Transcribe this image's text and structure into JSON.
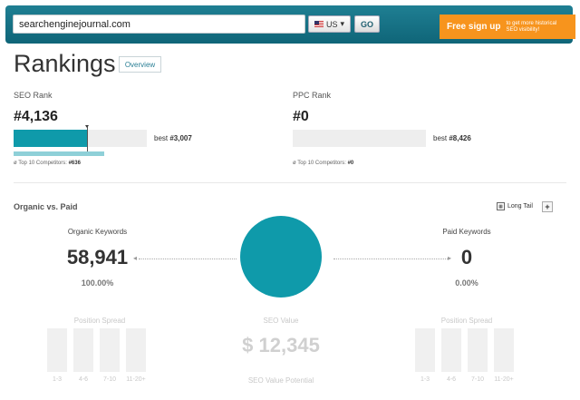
{
  "search": {
    "value": "searchenginejournal.com"
  },
  "country": {
    "label": "US"
  },
  "go_label": "GO",
  "signup": {
    "main": "Free sign up",
    "sub": "to get more historical SEO visibility!"
  },
  "page": {
    "title": "Rankings",
    "overview_label": "Overview"
  },
  "seo_rank": {
    "label": "SEO Rank",
    "value": "#4,136",
    "best_prefix": "best",
    "best_value": "#3,007",
    "fill_fraction": 0.55,
    "competitor_fraction": 0.68,
    "competitors_prefix": "ø Top 10 Competitors:",
    "competitors_value": "#636"
  },
  "ppc_rank": {
    "label": "PPC Rank",
    "value": "#0",
    "best_prefix": "best",
    "best_value": "#8,426",
    "fill_fraction": 0,
    "competitors_prefix": "ø Top 10 Competitors:",
    "competitors_value": "#0"
  },
  "organic_vs_paid": {
    "title": "Organic vs. Paid",
    "long_tail_label": "Long Tail",
    "organic": {
      "label": "Organic Keywords",
      "value": "58,941",
      "percent": "100.00%"
    },
    "paid": {
      "label": "Paid Keywords",
      "value": "0",
      "percent": "0.00%"
    }
  },
  "bottom": {
    "position_spread_label": "Position Spread",
    "seo_value_label": "SEO Value",
    "seo_value": "$ 12,345",
    "seo_value_potential_label": "SEO Value Potential",
    "spread_buckets": [
      "1-3",
      "4-6",
      "7-10",
      "11-20+"
    ]
  },
  "colors": {
    "topbar": "#1f7f93",
    "accent": "#0f9aaa",
    "signup": "#f7941d"
  }
}
